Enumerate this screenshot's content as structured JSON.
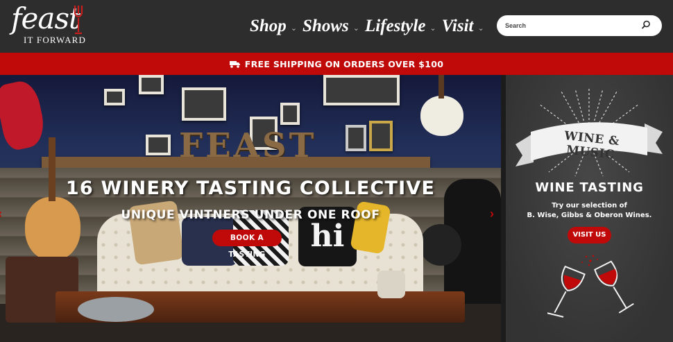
{
  "brand": {
    "script": "feast",
    "sub": "IT FORWARD"
  },
  "nav": [
    {
      "label": "Shop"
    },
    {
      "label": "Shows"
    },
    {
      "label": "Lifestyle"
    },
    {
      "label": "Visit"
    }
  ],
  "search": {
    "placeholder": "Search"
  },
  "shipping": {
    "text": "FREE SHIPPING ON ORDERS OVER $100"
  },
  "hero": {
    "title": "16 WINERY TASTING COLLECTIVE",
    "subtitle": "UNIQUE VINTNERS UNDER ONE ROOF",
    "button": "BOOK A TASTING",
    "sign_letters": "FEAST",
    "pillow_text": "hi"
  },
  "promo": {
    "ribbon": "WINE & MUSIC",
    "title": "WINE TASTING",
    "line1": "Try our selection of",
    "line2": "B. Wise, Gibbs & Oberon Wines.",
    "button": "VISIT US"
  },
  "colors": {
    "header_bg": "#2d2d2d",
    "accent_red": "#c00a0a",
    "promo_bg": "#3b3b3b"
  }
}
